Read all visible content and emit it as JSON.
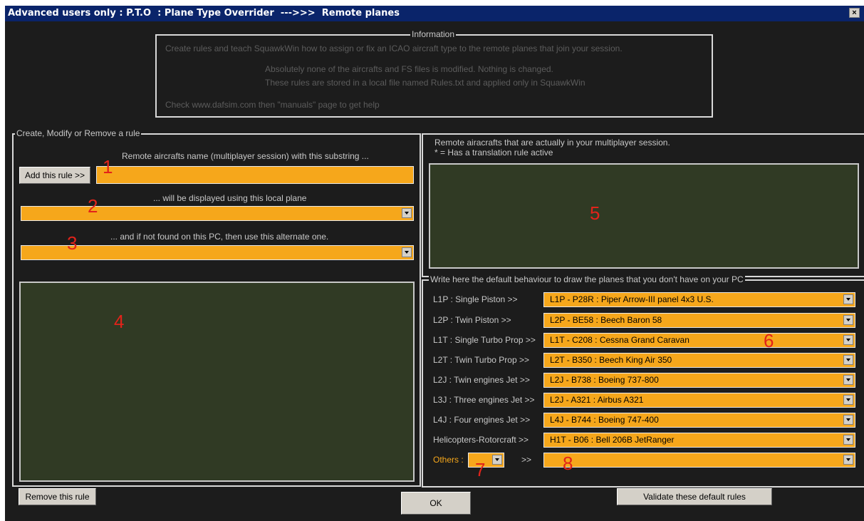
{
  "window": {
    "title": "Advanced users only : P.T.O  : Plane Type Overrider  --->>>  Remote planes",
    "close_glyph": "×"
  },
  "info": {
    "legend": "Information",
    "line1": "Create rules and teach SquawkWin how to assign or fix an ICAO aircraft type to the remote planes that join your session.",
    "line2": "Absolutely none of the aircrafts and FS files is modified.     Nothing is changed.",
    "line3": "These rules are stored in a local file named Rules.txt and applied only in SquawkWin",
    "line4": "Check www.dafsim.com   then \"manuals\" page to get help"
  },
  "rule": {
    "legend": "Create, Modify or Remove a rule",
    "substring_label": "Remote aircrafts name (multiplayer session) with this substring  ...",
    "add_button": "Add this rule >>",
    "substring_value": "",
    "local_label": "... will be displayed using this local plane",
    "local_value": "",
    "alt_label": "... and if not found on this PC, then use this alternate one.",
    "alt_value": "",
    "remove_button": "Remove this rule"
  },
  "remote": {
    "line1": "Remote airacrafts that are actually in your multiplayer session.",
    "line2": "* = Has a translation rule active"
  },
  "defaults": {
    "legend": "Write here the default behaviour to draw the planes that you don't have on your PC",
    "rows": [
      {
        "label": "L1P : Single Piston >>",
        "value": "L1P - P28R : Piper Arrow-III panel 4x3 U.S."
      },
      {
        "label": "L2P : Twin Piston >>",
        "value": "L2P - BE58 : Beech Baron 58"
      },
      {
        "label": "L1T : Single Turbo Prop >>",
        "value": "L1T - C208 : Cessna Grand Caravan"
      },
      {
        "label": "L2T : Twin Turbo Prop >>",
        "value": "L2T - B350 : Beech King Air 350"
      },
      {
        "label": "L2J : Twin engines Jet >>",
        "value": "L2J - B738 : Boeing 737-800"
      },
      {
        "label": "L3J : Three engines Jet >>",
        "value": "L2J - A321 : Airbus A321"
      },
      {
        "label": "L4J : Four engines Jet >>",
        "value": "L4J - B744 : Boeing 747-400"
      },
      {
        "label": "Helicopters-Rotorcraft >>",
        "value": "H1T - B06 : Bell 206B JetRanger"
      }
    ],
    "others_label": "Others :",
    "others_arrow": ">>",
    "others_value": "",
    "validate_button": "Validate these default rules"
  },
  "ok_button": "OK",
  "markers": {
    "m1": "1",
    "m2": "2",
    "m3": "3",
    "m4": "4",
    "m5": "5",
    "m6": "6",
    "m7": "7",
    "m8": "8"
  },
  "colors": {
    "field": "#f6a71b",
    "panel": "#303a24",
    "marker": "#e2231a",
    "titlebar": "#0a246a"
  }
}
